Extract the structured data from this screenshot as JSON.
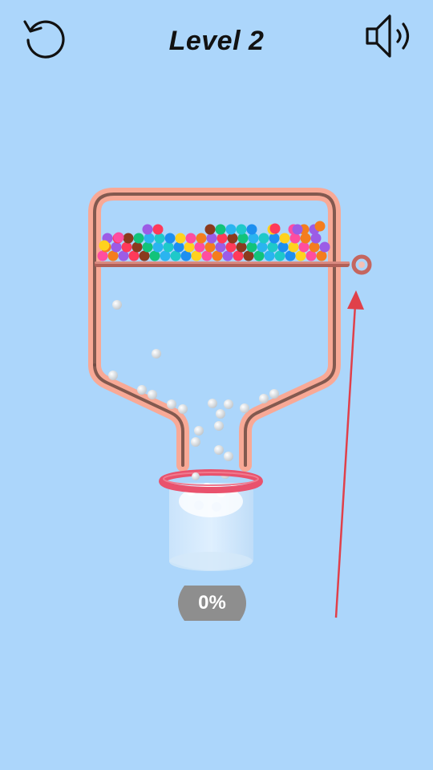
{
  "header": {
    "level_label": "Level 2",
    "restart_icon": "restart-icon",
    "sound_icon": "speaker-icon"
  },
  "progress": {
    "label": "0%",
    "value": 0
  },
  "colors": {
    "background": "#acd6fb",
    "container_outline": "#f8a996",
    "container_inner": "#6e4b43",
    "pin": "#c5665f",
    "cup_rim": "#e9526d",
    "hint_arrow": "#e0404a",
    "progress_badge": "#8e8e8e"
  },
  "balls": {
    "palette": [
      "#ff4da0",
      "#ff3a5a",
      "#2ab4f0",
      "#ffd21e",
      "#9c5ce6",
      "#12c37a",
      "#1d8ff0",
      "#f47d1e",
      "#8b3a1e",
      "#1fc9c9"
    ]
  }
}
